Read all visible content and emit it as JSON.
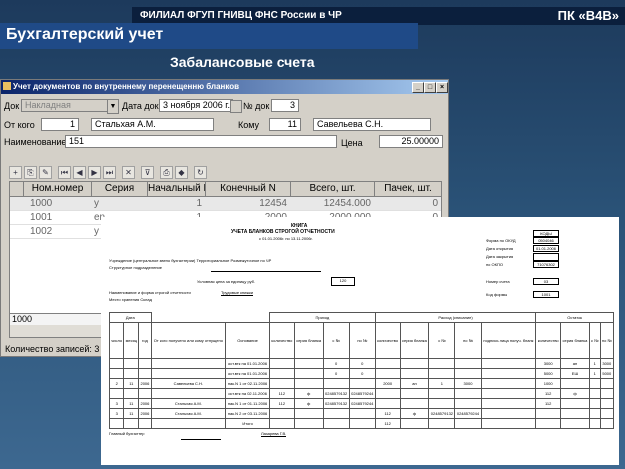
{
  "header": {
    "org": "ФИЛИАЛ ФГУП ГНИВЦ ФНС России в ЧР",
    "code": "ПК «В4В»"
  },
  "title": "Бухгалтерский учет",
  "subtitle": "Забалансовые счета",
  "window": {
    "title": "Учет документов по внутреннему перенещенню бланков",
    "form": {
      "doc_label": "Док",
      "doc_value": "Накладная",
      "date_label": "Дата док",
      "date_value": "3 ноября 2006 г.",
      "num_label": "№ док",
      "num_value": "3",
      "from_label": "От кого",
      "from_code": "1",
      "from_name": "Стальхая А.М.",
      "to_label": "Кому",
      "to_code": "11",
      "to_name": "Савельева С.Н.",
      "name_label": "Наименование",
      "name_code": "151",
      "price_label": "Цена",
      "price_value": "25.00000"
    },
    "grid": {
      "columns": [
        "Ном.номер",
        "Серия",
        "Начальный N",
        "Конечный N",
        "Всего, шт.",
        "Пачек, шт."
      ],
      "rows": [
        [
          "1000",
          "y",
          "1",
          "12454",
          "12454.000",
          "0"
        ],
        [
          "1001",
          "en",
          "1",
          "2000",
          "2000.000",
          "0"
        ],
        [
          "1002",
          "y",
          "",
          "",
          "",
          ""
        ]
      ],
      "footer": "1000"
    },
    "status": "Количество записей: 3"
  },
  "book": {
    "title": "КНИГА",
    "subtitle": "УЧЕТА БЛАНКОВ СТРОГОЙ ОТЧЕТНОСТИ",
    "period": "с 01.01.2006г. по 13.11.2006г.",
    "org_line": "Учреждение (центральное звено бухгалтерии) Территориальное Розмежуточное по ЧР",
    "division": "Структурное подразделение",
    "unit_label": "Условная цена за единицу руб.",
    "unit_value": "120",
    "resp_line": "Наименование и форма строгой отчетности",
    "resp_value": "Трудовые книжки",
    "storage": "Место хранения    Склад",
    "codes": [
      {
        "label": "Форма по ОКУД",
        "value": "0504046"
      },
      {
        "label": "Дата открытия",
        "value": "01.01.2006"
      },
      {
        "label": "Дата закрытия",
        "value": ""
      },
      {
        "label": "по ОКПО",
        "value": "71076302"
      },
      {
        "label": "Номер счета",
        "value": "03"
      },
      {
        "label": "Код формы",
        "value": "1001"
      }
    ],
    "codes_header": "КОДЫ",
    "table_headers": [
      "Дата",
      "Приход",
      "Расход (списание)",
      "Остаток"
    ],
    "sub_headers": [
      "число",
      "месяц",
      "год",
      "От кого получено или кому отпущено",
      "Основание",
      "количество",
      "серия бланка",
      "с №",
      "по №",
      "количество",
      "серия бланка",
      "с №",
      "по №",
      "подпись лица получ. бланк",
      "количество",
      "серия бланка",
      "с №",
      "по №"
    ],
    "rows": [
      [
        "",
        "",
        "",
        "",
        "ост.втк на 01.01.2006",
        "",
        "",
        "0",
        "0",
        "",
        "",
        "",
        "",
        "",
        "3000",
        "ап",
        "1",
        "3000"
      ],
      [
        "",
        "",
        "",
        "",
        "ост.втк на 01.01.2006",
        "",
        "",
        "0",
        "0",
        "",
        "",
        "",
        "",
        "",
        "5000",
        "ЕШ",
        "1",
        "5000"
      ],
      [
        "2",
        "11",
        "2006",
        "Савельева С.Н.",
        "нак.N 1 от 02.11.2006",
        "",
        "",
        "",
        "",
        "2000",
        "ап",
        "1",
        "3000",
        "",
        "1000",
        "",
        "",
        ""
      ],
      [
        "",
        "",
        "",
        "",
        "ост.втк на 02.11.2006",
        "112",
        "ф",
        "0248579132",
        "0248579244",
        "",
        "",
        "",
        "",
        "",
        "112",
        "ф",
        "",
        ""
      ],
      [
        "3",
        "11",
        "2006",
        "Стальхая А.М.",
        "нак.N 1 от 01.11.2006",
        "112",
        "ф",
        "0248579132",
        "0248579244",
        "",
        "",
        "",
        "",
        "",
        "112",
        "",
        "",
        ""
      ],
      [
        "3",
        "11",
        "2006",
        "Стальхая А.М.",
        "нак.N 2 от 03.11.2006",
        "",
        "",
        "",
        "",
        "112",
        "ф",
        "0248579132",
        "0248579244",
        "",
        "",
        "",
        "",
        ""
      ],
      [
        "",
        "",
        "",
        "",
        "Итого",
        "",
        "",
        "",
        "",
        "112",
        "",
        "",
        "",
        "",
        "",
        "",
        "",
        ""
      ]
    ],
    "chief": "Главный бухгалтер",
    "chief_name": "Лазарева Г.В."
  }
}
